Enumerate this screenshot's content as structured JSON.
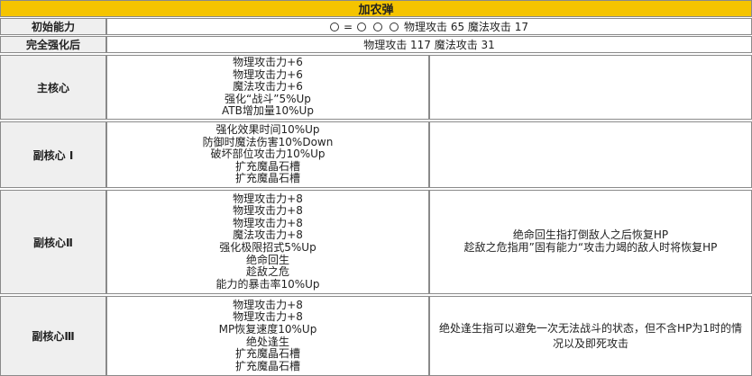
{
  "title": "加农弹",
  "initial": {
    "label": "初始能力",
    "slot_eq": "=",
    "stats": "物理攻击 65 魔法攻击 17"
  },
  "full": {
    "label": "完全强化后",
    "stats": "物理攻击 117 魔法攻击 31"
  },
  "rows": [
    {
      "label": "主核心",
      "effects": [
        "物理攻击力+6",
        "物理攻击力+6",
        "魔法攻击力+6",
        "强化“战斗”5%Up",
        "ATB增加量10%Up"
      ],
      "notes": []
    },
    {
      "label": "副核心 Ⅰ",
      "effects": [
        "强化效果时间10%Up",
        "防御时魔法伤害10%Down",
        "破坏部位攻击力10%Up",
        "扩充魔晶石槽",
        "扩充魔晶石槽"
      ],
      "notes": []
    },
    {
      "label": "副核心Ⅱ",
      "effects": [
        "物理攻击力+8",
        "物理攻击力+8",
        "物理攻击力+8",
        "魔法攻击力+8",
        "强化极限招式5%Up",
        "绝命回生",
        "趁敌之危",
        "能力的暴击率10%Up"
      ],
      "notes": [
        "绝命回生指打倒敌人之后恢复HP",
        "趁敌之危指用”固有能力“攻击力竭的敌人时将恢复HP"
      ]
    },
    {
      "label": "副核心Ⅲ",
      "effects": [
        "物理攻击力+8",
        "物理攻击力+8",
        "MP恢复速度10%Up",
        "绝处逢生",
        "扩充魔晶石槽",
        "扩充魔晶石槽"
      ],
      "notes": [
        "绝处逢生指可以避免一次无法战斗的状态，但不含HP为1时的情况以及即死攻击"
      ]
    }
  ]
}
